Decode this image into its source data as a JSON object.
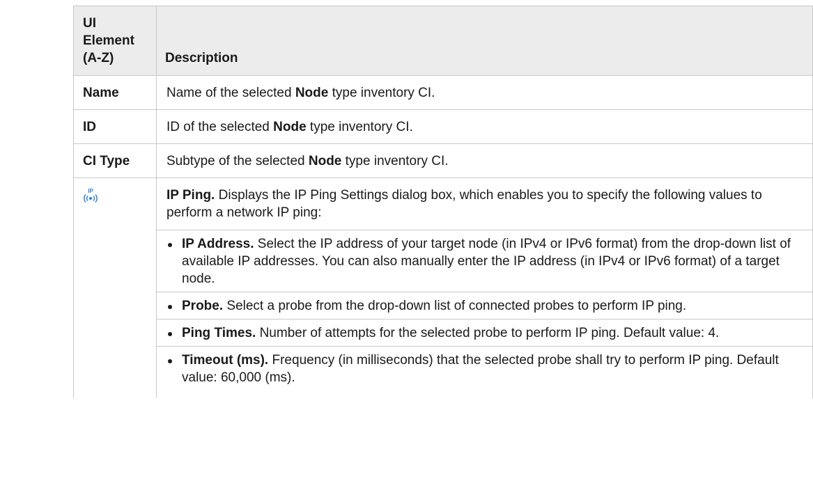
{
  "table": {
    "headers": [
      "UI Element (A-Z)",
      "Description"
    ],
    "rows": [
      {
        "element": "Name",
        "desc_before": "Name of the selected ",
        "desc_bold": "Node",
        "desc_after": " type inventory CI."
      },
      {
        "element": "ID",
        "desc_before": "ID of the selected ",
        "desc_bold": "Node",
        "desc_after": " type inventory CI."
      },
      {
        "element": "CI Type",
        "desc_before": "Subtype of the selected ",
        "desc_bold": "Node",
        "desc_after": " type inventory CI."
      }
    ],
    "ping": {
      "icon": "ip-ping-icon",
      "icon_text": "IP",
      "title": "IP Ping.",
      "intro": " Displays the IP Ping Settings dialog box, which enables you to specify the following values to perform a network IP ping:",
      "options": [
        {
          "term": "IP Address.",
          "text": " Select the IP address of your target node (in IPv4 or IPv6 format) from the drop-down list of available IP addresses. You can also manually enter the IP address (in IPv4 or IPv6 format) of a target node."
        },
        {
          "term": "Probe.",
          "text": " Select a probe from the drop-down list of connected probes to perform IP ping."
        },
        {
          "term": "Ping Times.",
          "text": " Number of attempts for the selected probe to perform IP ping. Default value: 4."
        },
        {
          "term": "Timeout (ms).",
          "text": " Frequency (in milliseconds) that the selected probe shall try to perform IP ping. Default value: 60,000 (ms)."
        }
      ]
    }
  },
  "colors": {
    "header_bg": "#ececec",
    "border": "#c8c8c8",
    "icon_blue": "#2f7fd6"
  }
}
